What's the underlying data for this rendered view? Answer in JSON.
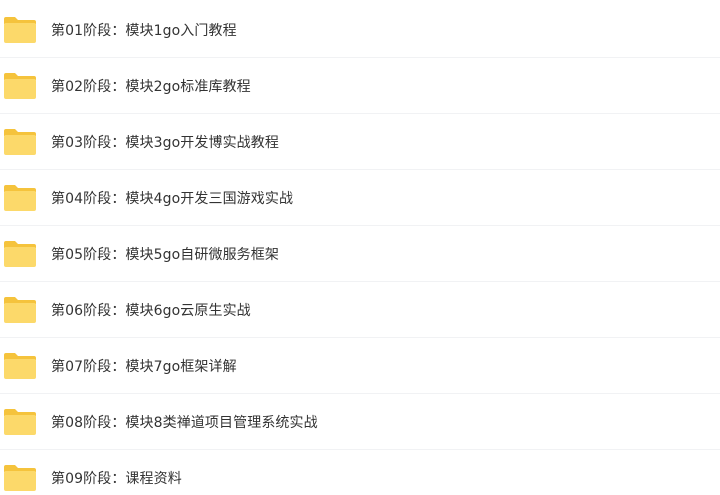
{
  "colors": {
    "folder_back": "#f5c33c",
    "folder_front": "#fcd96a",
    "text": "#333333",
    "divider": "#f1f2f4"
  },
  "file_list": {
    "items": [
      {
        "label": "第01阶段：模块1go入门教程",
        "icon": "folder-icon"
      },
      {
        "label": "第02阶段：模块2go标准库教程",
        "icon": "folder-icon"
      },
      {
        "label": "第03阶段：模块3go开发博实战教程",
        "icon": "folder-icon"
      },
      {
        "label": "第04阶段：模块4go开发三国游戏实战",
        "icon": "folder-icon"
      },
      {
        "label": "第05阶段：模块5go自研微服务框架",
        "icon": "folder-icon"
      },
      {
        "label": "第06阶段：模块6go云原生实战",
        "icon": "folder-icon"
      },
      {
        "label": "第07阶段：模块7go框架详解",
        "icon": "folder-icon"
      },
      {
        "label": "第08阶段：模块8类禅道项目管理系统实战",
        "icon": "folder-icon"
      },
      {
        "label": "第09阶段：课程资料",
        "icon": "folder-icon"
      }
    ]
  }
}
